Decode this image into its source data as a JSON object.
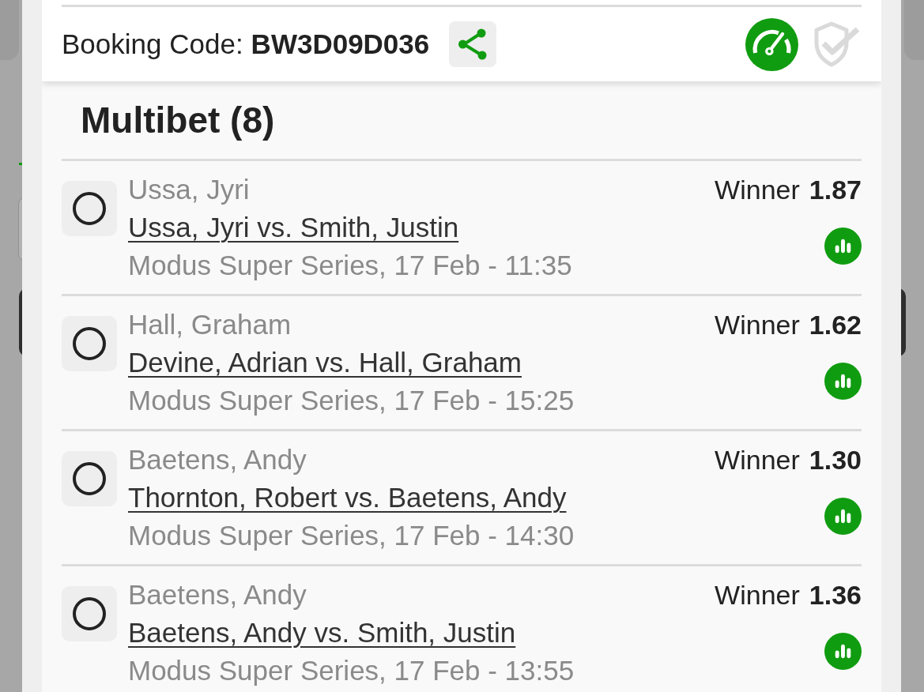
{
  "header": {
    "booking_label": "Booking Code:",
    "booking_code": "BW3D09D036"
  },
  "title": "Multibet (8)",
  "selections": [
    {
      "selected": false,
      "pick": "Ussa, Jyri",
      "match": "Ussa, Jyri vs. Smith, Justin",
      "details": "Modus Super Series, 17 Feb - 11:35",
      "market": "Winner",
      "odds": "1.87"
    },
    {
      "selected": false,
      "pick": "Hall, Graham",
      "match": "Devine, Adrian vs. Hall, Graham",
      "details": "Modus Super Series, 17 Feb - 15:25",
      "market": "Winner",
      "odds": "1.62"
    },
    {
      "selected": false,
      "pick": "Baetens, Andy",
      "match": "Thornton, Robert vs. Baetens, Andy",
      "details": "Modus Super Series, 17 Feb - 14:30",
      "market": "Winner",
      "odds": "1.30"
    },
    {
      "selected": false,
      "pick": "Baetens, Andy",
      "match": "Baetens, Andy vs. Smith, Justin",
      "details": "Modus Super Series, 17 Feb - 13:55",
      "market": "Winner",
      "odds": "1.36"
    }
  ]
}
